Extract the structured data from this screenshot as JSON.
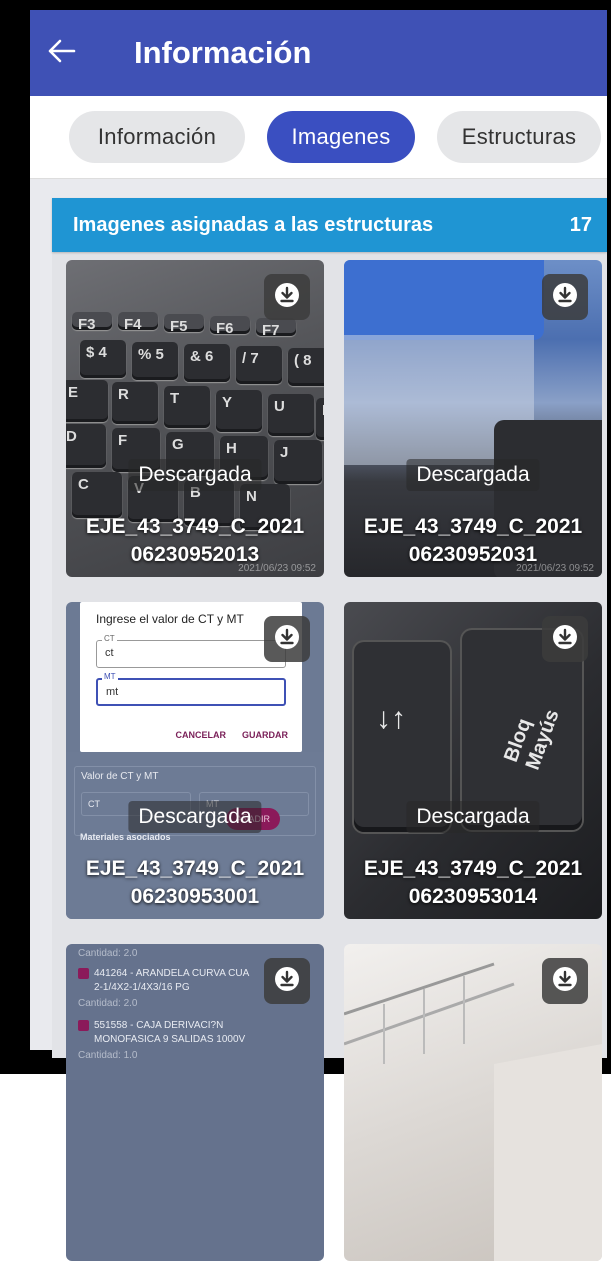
{
  "appbar": {
    "title": "Información"
  },
  "tabs": [
    {
      "label": "Información",
      "active": false
    },
    {
      "label": "Imagenes",
      "active": true
    },
    {
      "label": "Estructuras",
      "active": false
    }
  ],
  "panel": {
    "title": "Imagenes asignadas a las estructuras",
    "count": "17"
  },
  "images": [
    {
      "status": "Descargada",
      "name_line1": "EJE_43_3749_C_2021",
      "name_line2": "06230952013",
      "stamp": "2021/06/23 09:52"
    },
    {
      "status": "Descargada",
      "name_line1": "EJE_43_3749_C_2021",
      "name_line2": "06230952031",
      "stamp": "2021/06/23 09:52"
    },
    {
      "status": "Descargada",
      "name_line1": "EJE_43_3749_C_2021",
      "name_line2": "06230953001"
    },
    {
      "status": "Descargada",
      "name_line1": "EJE_43_3749_C_2021",
      "name_line2": "06230953014"
    },
    {
      "status": "",
      "name_line1": "",
      "name_line2": ""
    },
    {
      "status": "",
      "name_line1": "",
      "name_line2": ""
    }
  ],
  "photo_dialog": {
    "title": "Ingrese el valor de CT y MT",
    "ct_label": "CT",
    "ct_value": "ct",
    "mt_label": "MT",
    "mt_value": "mt",
    "cancel": "CANCELAR",
    "save": "GUARDAR",
    "section_ct_mt": "Valor de CT y MT",
    "ct_short": "CT",
    "mt_short": "MT",
    "materials": "Materiales asociados",
    "add": "AÑADIR"
  },
  "photo_list": {
    "qty1": "Cantidad: 2.0",
    "item1": "441264 - ARANDELA CURVA CUA",
    "item1b": "2-1/4X2-1/4X3/16 PG",
    "qty2": "Cantidad: 2.0",
    "item2": "551558 - CAJA DERIVACI?N",
    "item2b": "MONOFASICA 9 SALIDAS 1000V",
    "qty3": "Cantidad: 1.0"
  },
  "photo_keyboard": {
    "keys": [
      "F3",
      "F4",
      "F5",
      "F6",
      "F7",
      "$ 4",
      "% 5",
      "& 6",
      "/ 7",
      "( 8",
      "E",
      "R",
      "T",
      "Y",
      "U",
      "I",
      "D",
      "F",
      "G",
      "H",
      "J",
      "C",
      "V",
      "B",
      "N"
    ]
  },
  "photo_bloq": {
    "arrows": "↓↑",
    "key_label": "Bloq Mayús"
  },
  "colors": {
    "appbar": "#3f51b5",
    "tab_active": "#3a4fc1",
    "panel_header": "#1f95d3"
  },
  "icons": {
    "back": "arrow-left-icon",
    "download": "download-icon"
  }
}
